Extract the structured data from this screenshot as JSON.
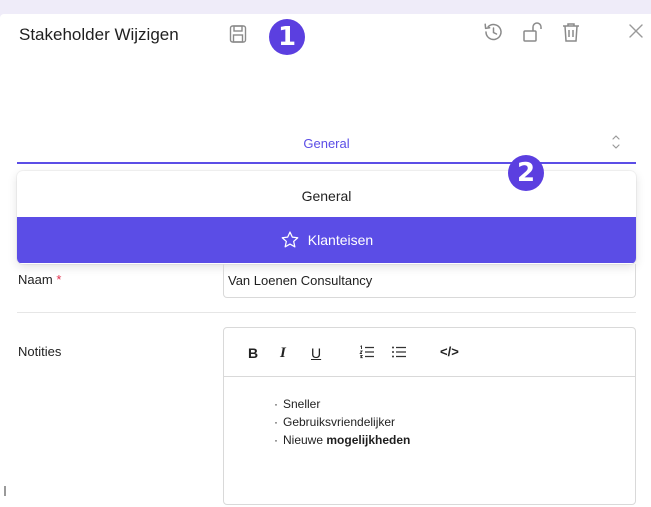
{
  "header": {
    "title": "Stakeholder Wijzigen",
    "badge1": "1",
    "badge2": "2"
  },
  "select": {
    "value": "General"
  },
  "dropdown": {
    "options": [
      {
        "label": "General",
        "selected": false
      },
      {
        "label": "Klanteisen",
        "selected": true,
        "icon": "star-icon"
      }
    ]
  },
  "form": {
    "naam_label": "Naam",
    "naam_required": "*",
    "naam_value": "Van Loenen Consultancy",
    "notities_label": "Notities"
  },
  "editor": {
    "toolbar": {
      "bold": "B",
      "italic": "I",
      "underline": "U",
      "code": "</>"
    },
    "bullets": [
      {
        "text": "Sneller",
        "bold_part": ""
      },
      {
        "text": "Gebruiksvriendelijker",
        "bold_part": ""
      },
      {
        "text": "Nieuwe ",
        "bold_part": "mogelijkheden"
      }
    ]
  },
  "colors": {
    "accent": "#5b4de6",
    "badge": "#5b3fe0",
    "background": "#efecf9",
    "required": "#e0304d"
  }
}
